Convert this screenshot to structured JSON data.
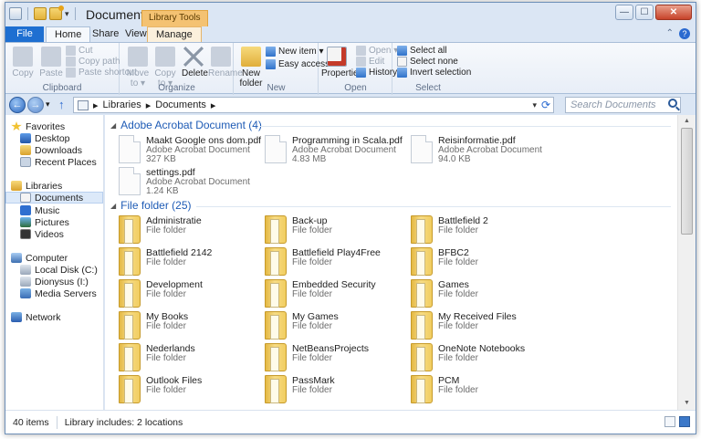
{
  "window": {
    "title": "Documents",
    "contextual_tab": "Library Tools"
  },
  "window_controls": {
    "minimize": "—",
    "maximize": "☐",
    "close": "✕"
  },
  "ribbon_tabs": [
    "File",
    "Home",
    "Share",
    "View",
    "Manage"
  ],
  "ribbon": {
    "clipboard": {
      "label": "Clipboard",
      "copy": "Copy",
      "paste": "Paste",
      "cut": "Cut",
      "copy_path": "Copy path",
      "paste_shortcut": "Paste shortcut"
    },
    "organize": {
      "label": "Organize",
      "move_to": "Move to ▾",
      "copy_to": "Copy to ▾",
      "delete": "Delete",
      "rename": "Rename"
    },
    "new": {
      "label": "New",
      "new_folder": "New folder",
      "new_item": "New item ▾",
      "easy_access": "Easy access ▾"
    },
    "open": {
      "label": "Open",
      "properties": "Properties",
      "open": "Open ▾",
      "edit": "Edit",
      "history": "History"
    },
    "select": {
      "label": "Select",
      "select_all": "Select all",
      "select_none": "Select none",
      "invert_selection": "Invert selection"
    }
  },
  "address": {
    "breadcrumb_sep": "▸",
    "crumbs": [
      "Libraries",
      "Documents"
    ],
    "search_placeholder": "Search Documents"
  },
  "nav": {
    "favorites": "Favorites",
    "desktop": "Desktop",
    "downloads": "Downloads",
    "recent": "Recent Places",
    "libraries": "Libraries",
    "documents": "Documents",
    "music": "Music",
    "pictures": "Pictures",
    "videos": "Videos",
    "computer": "Computer",
    "local_disk": "Local Disk (C:)",
    "dionysus": "Dionysus (I:)",
    "media": "Media Servers",
    "network": "Network"
  },
  "groups": {
    "pdf": {
      "header": "Adobe Acrobat Document (4)",
      "items": [
        {
          "name": "Maakt Google ons dom.pdf",
          "type": "Adobe Acrobat Document",
          "size": "327 KB"
        },
        {
          "name": "Programming in Scala.pdf",
          "type": "Adobe Acrobat Document",
          "size": "4.83 MB"
        },
        {
          "name": "Reisinformatie.pdf",
          "type": "Adobe Acrobat Document",
          "size": "94.0 KB"
        },
        {
          "name": "settings.pdf",
          "type": "Adobe Acrobat Document",
          "size": "1.24 KB"
        }
      ]
    },
    "folders": {
      "header": "File folder (25)",
      "items": [
        {
          "name": "Administratie",
          "type": "File folder"
        },
        {
          "name": "Back-up",
          "type": "File folder"
        },
        {
          "name": "Battlefield 2",
          "type": "File folder"
        },
        {
          "name": "Battlefield 2142",
          "type": "File folder"
        },
        {
          "name": "Battlefield Play4Free",
          "type": "File folder"
        },
        {
          "name": "BFBC2",
          "type": "File folder"
        },
        {
          "name": "Development",
          "type": "File folder"
        },
        {
          "name": "Embedded Security",
          "type": "File folder"
        },
        {
          "name": "Games",
          "type": "File folder"
        },
        {
          "name": "My Books",
          "type": "File folder"
        },
        {
          "name": "My Games",
          "type": "File folder"
        },
        {
          "name": "My Received Files",
          "type": "File folder"
        },
        {
          "name": "Nederlands",
          "type": "File folder"
        },
        {
          "name": "NetBeansProjects",
          "type": "File folder"
        },
        {
          "name": "OneNote Notebooks",
          "type": "File folder"
        },
        {
          "name": "Outlook Files",
          "type": "File folder"
        },
        {
          "name": "PassMark",
          "type": "File folder"
        },
        {
          "name": "PCM",
          "type": "File folder"
        }
      ]
    }
  },
  "status": {
    "count": "40 items",
    "library_info": "Library includes: 2 locations"
  }
}
